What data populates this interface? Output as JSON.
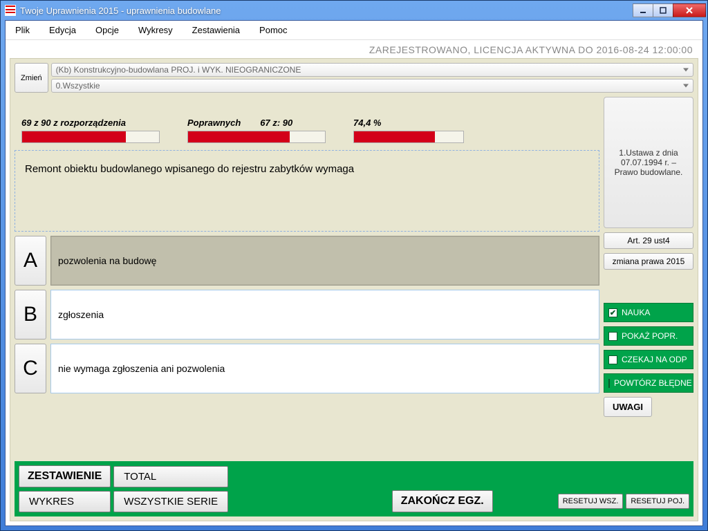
{
  "window": {
    "title": "Twoje Uprawnienia 2015 - uprawnienia budowlane"
  },
  "menu": [
    "Plik",
    "Edycja",
    "Opcje",
    "Wykresy",
    "Zestawienia",
    "Pomoc"
  ],
  "status": "ZAREJESTROWANO, LICENCJA AKTYWNA DO 2016-08-24 12:00:00",
  "toolbar": {
    "change_label": "Zmień",
    "dropdown1": "(Kb) Konstrukcyjno-budowlana  PROJ. i WYK. NIEOGRANICZONE",
    "dropdown2": "0.Wszystkie"
  },
  "progress": {
    "p1": {
      "label": "69 z 90 z rozporządzenia",
      "pct": 76
    },
    "p2": {
      "label_a": "Poprawnych",
      "label_b": "67 z: 90",
      "pct": 74
    },
    "p3": {
      "label": "74,4 %",
      "pct": 74
    }
  },
  "question": "Remont obiektu budowlanego wpisanego do rejestru zabytków wymaga",
  "answers": {
    "a": "pozwolenia na budowę",
    "b": "zgłoszenia",
    "c": "nie wymaga zgłoszenia ani pozwolenia"
  },
  "law_ref": "1.Ustawa z dnia 07.07.1994 r. – Prawo budowlane.",
  "side": {
    "art": "Art. 29 ust4",
    "zmiana": "zmiana prawa 2015",
    "checks": [
      {
        "label": "NAUKA",
        "checked": true
      },
      {
        "label": "POKAŻ POPR.",
        "checked": false
      },
      {
        "label": "CZEKAJ NA ODP",
        "checked": false
      },
      {
        "label": "POWTÓRZ BŁĘDNE",
        "checked": false
      }
    ],
    "uwagi": "UWAGI"
  },
  "footer": {
    "zestawienie": "ZESTAWIENIE",
    "total": "TOTAL",
    "wykres": "WYKRES",
    "wszystkie": "WSZYSTKIE SERIE",
    "zakoncz": "ZAKOŃCZ EGZ.",
    "resetwsz": "RESETUJ WSZ.",
    "resetpoj": "RESETUJ POJ."
  }
}
